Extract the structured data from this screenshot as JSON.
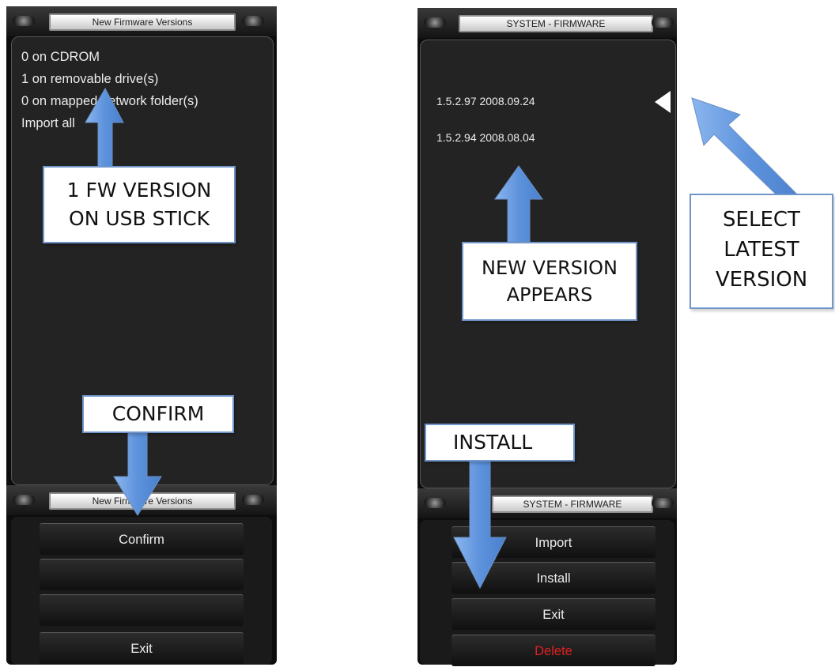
{
  "left": {
    "title": "New Firmware Versions",
    "lines": [
      "0 on CDROM",
      "1 on removable drive(s)",
      "0 on mapped network folder(s)",
      "Import all"
    ],
    "bottom_title": "New Firmware Versions",
    "buttons": [
      "Confirm",
      "",
      "",
      "Exit"
    ]
  },
  "right": {
    "title": "SYSTEM - FIRMWARE",
    "versions": [
      "1.5.2.97 2008.09.24",
      "1.5.2.94 2008.08.04"
    ],
    "selected_marker_icon": "triangle-left-icon",
    "bottom_title": "SYSTEM - FIRMWARE",
    "buttons": [
      "Import",
      "Install",
      "Exit",
      "Delete"
    ],
    "delete_color": "#e02020"
  },
  "callouts": {
    "usb": [
      "1 FW VERSION",
      "ON USB STICK"
    ],
    "confirm": "CONFIRM",
    "new_version": [
      "NEW VERSION",
      "APPEARS"
    ],
    "select_latest": [
      "SELECT",
      "LATEST",
      "VERSION"
    ],
    "install": "INSTALL"
  },
  "colors": {
    "panel": "#0d0d0d",
    "content": "#232323",
    "arrow_fill": "#6f9fe0",
    "callout_border": "#6f95c9"
  }
}
